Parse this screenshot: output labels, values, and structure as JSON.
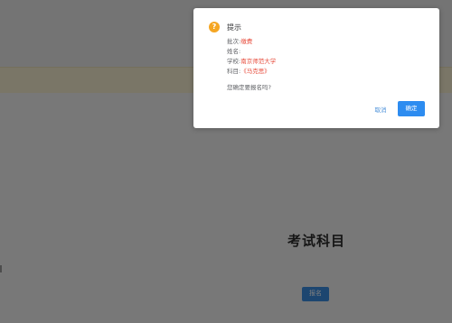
{
  "page": {
    "exam_subject_title": "考试科目",
    "signup_button_label": "报名"
  },
  "dialog": {
    "title": "提示",
    "icon_glyph": "?",
    "fields": [
      {
        "label": "批次:",
        "value": "缴费"
      },
      {
        "label": "姓名:",
        "value": ""
      },
      {
        "label": "学校:",
        "value": "南京师范大学"
      },
      {
        "label": "科目:",
        "value": "《马克思》"
      }
    ],
    "question": "您确定要报名吗?",
    "cancel_label": "取消",
    "ok_label": "确定"
  },
  "colors": {
    "overlay": "rgba(0,0,0,0.5)",
    "primary": "#2d8cf0",
    "warning": "#f5a623",
    "highlight_value": "#e74c3c"
  }
}
